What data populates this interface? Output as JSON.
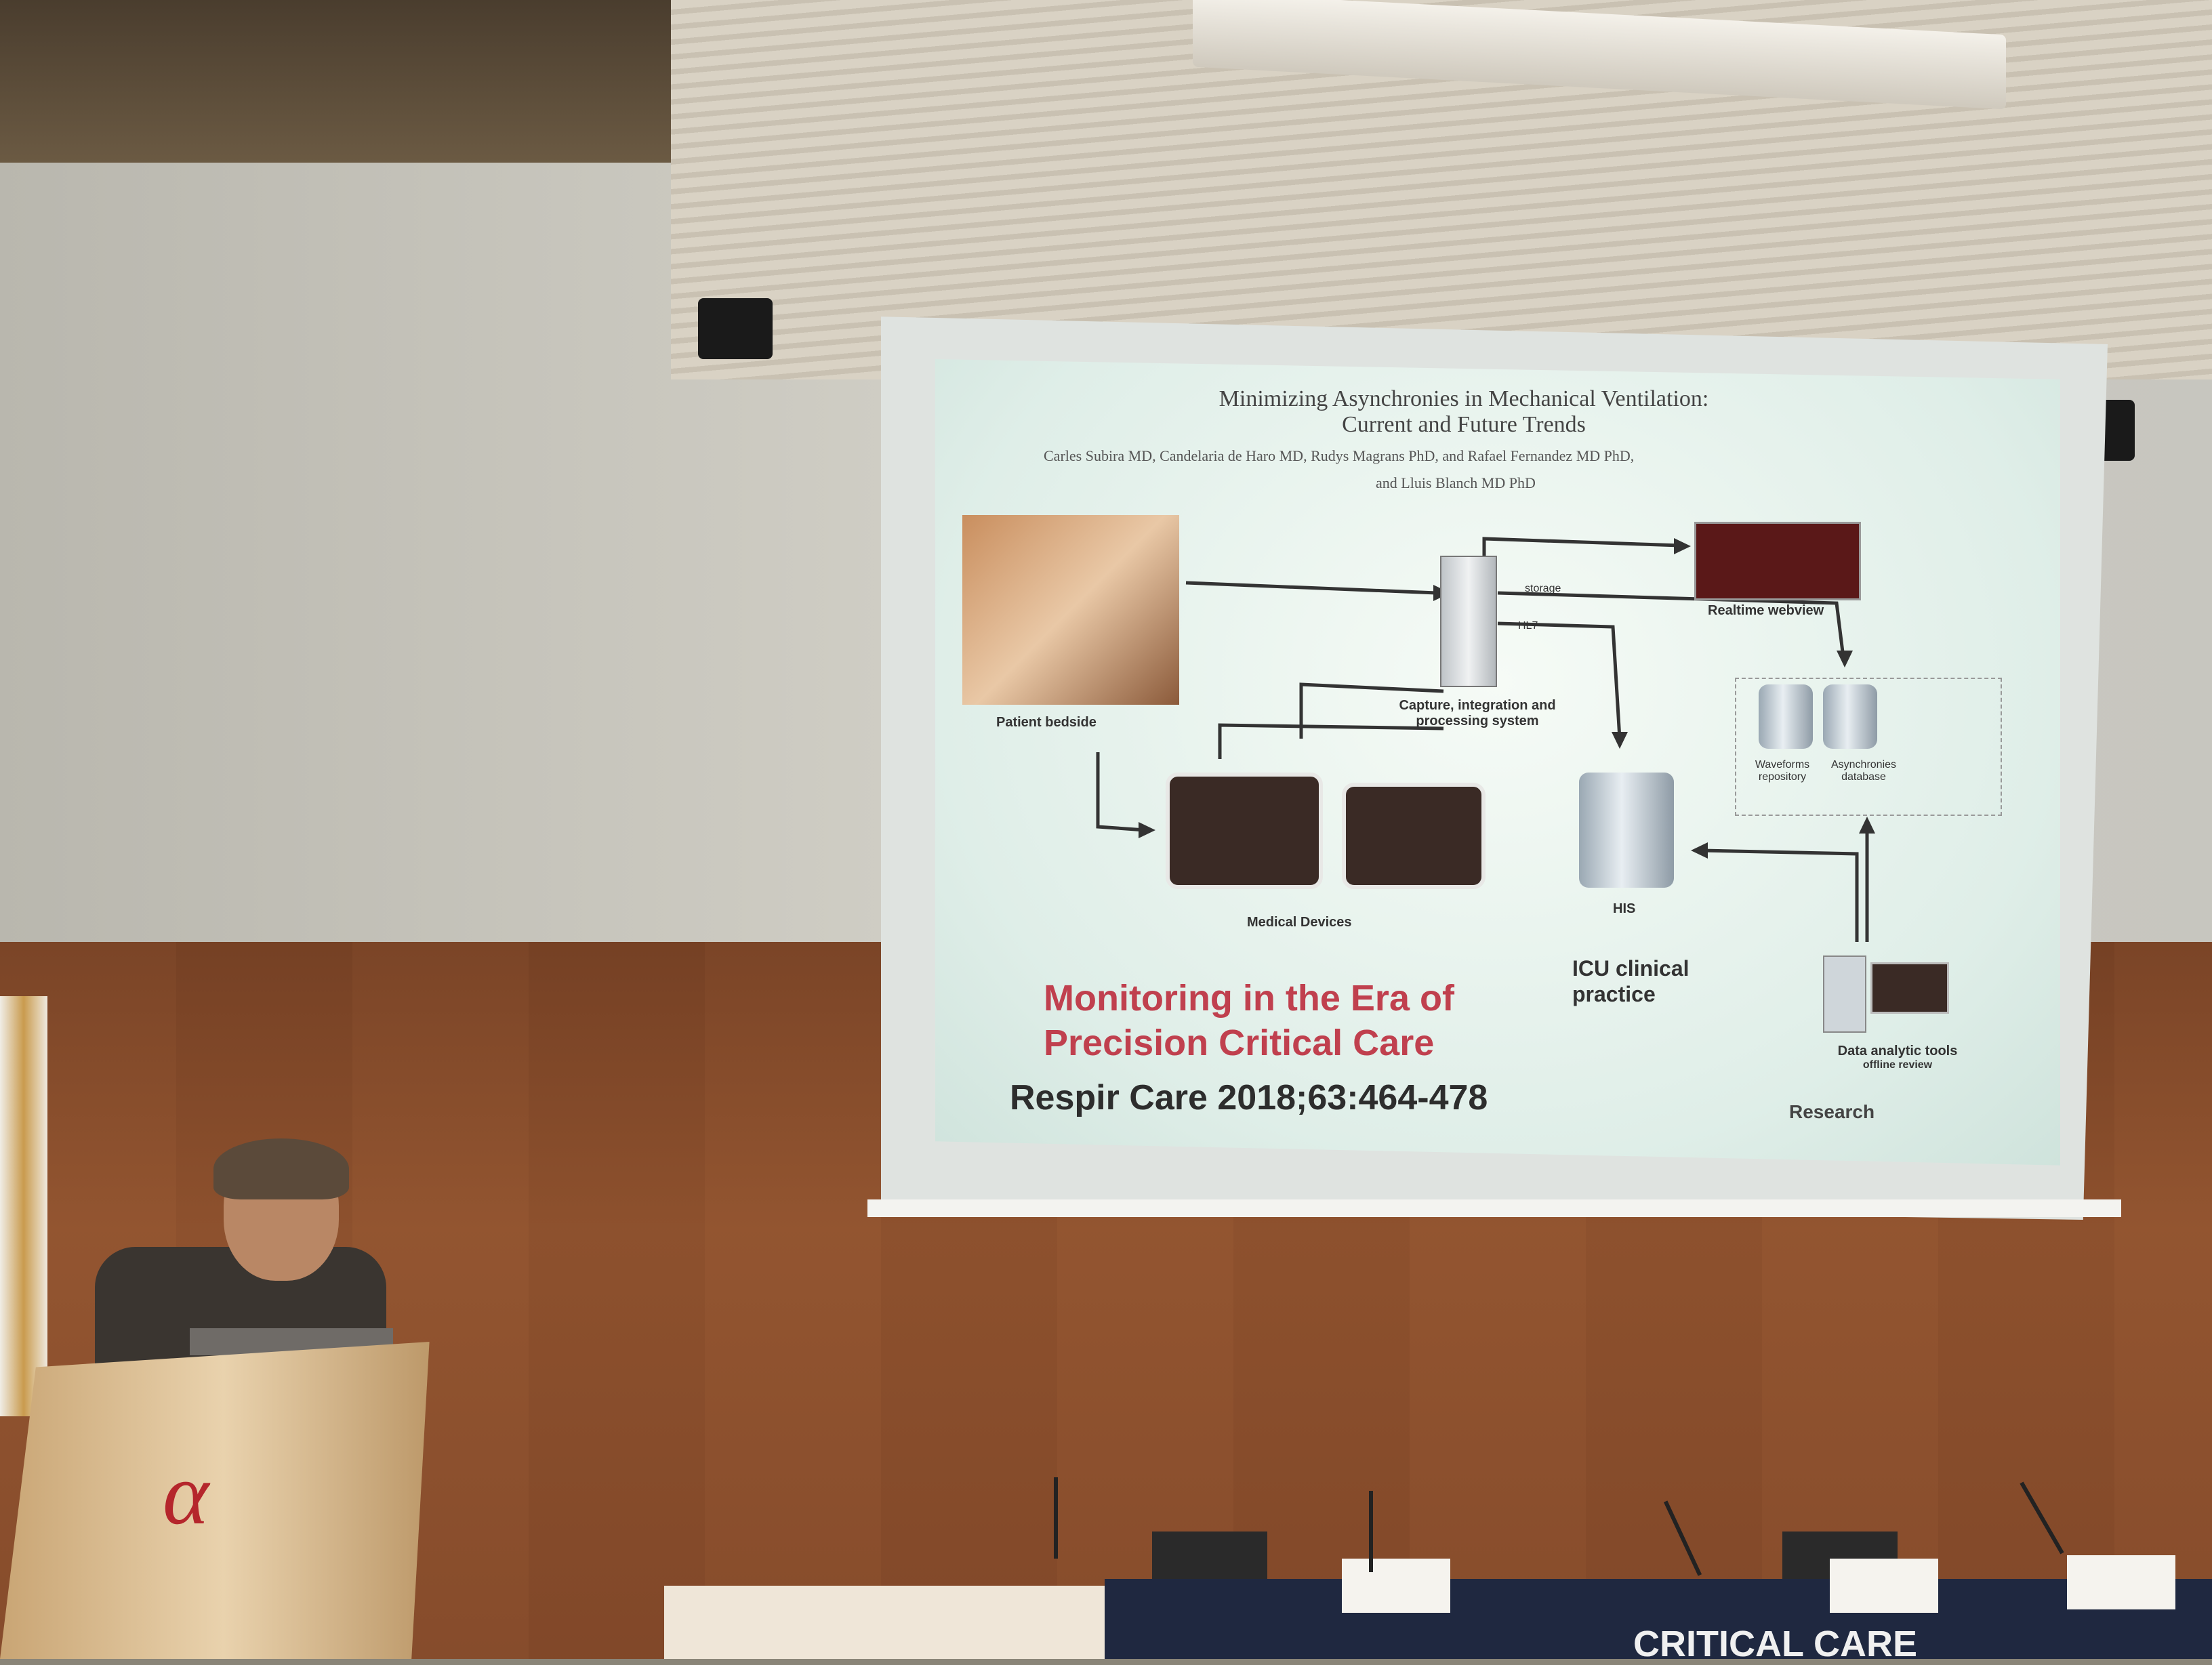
{
  "slide": {
    "title_line1": "Minimizing Asynchronies in Mechanical Ventilation:",
    "title_line2": "Current and Future Trends",
    "authors_line1": "Carles Subira MD, Candelaria de Haro MD, Rudys Magrans PhD, and Rafael Fernandez MD PhD,",
    "authors_line2": "and Lluis Blanch MD PhD",
    "heading_line1": "Monitoring in the Era of",
    "heading_line2": "Precision Critical Care",
    "citation": "Respir Care 2018;63:464-478"
  },
  "diagram": {
    "patient_bedside": "Patient bedside",
    "capture_system_line1": "Capture, integration and",
    "capture_system_line2": "processing system",
    "medical_devices": "Medical Devices",
    "realtime_webview": "Realtime webview",
    "his": "HIS",
    "icu_practice_line1": "ICU clinical",
    "icu_practice_line2": "practice",
    "waveforms_repository_line1": "Waveforms",
    "waveforms_repository_line2": "repository",
    "asynchronies_database_line1": "Asynchronies",
    "asynchronies_database_line2": "database",
    "data_tools_line1": "Data analytic tools",
    "data_tools_line2": "offline review",
    "research": "Research",
    "storage": "storage",
    "hl7": "HL7"
  },
  "room": {
    "banner": "CRITICAL CARE"
  },
  "colors": {
    "heading_red": "#c0404e",
    "slide_bg": "#e6f2ed",
    "banner_navy": "#1f2840"
  }
}
